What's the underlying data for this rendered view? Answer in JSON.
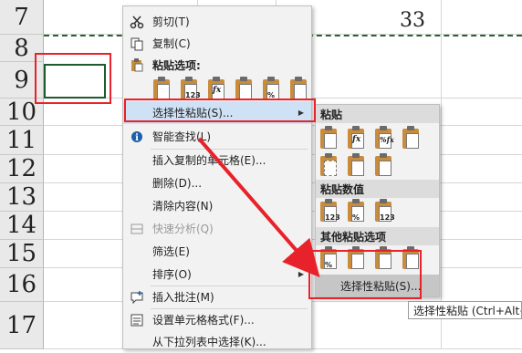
{
  "sheet": {
    "row_numbers": [
      "7",
      "8",
      "9",
      "10",
      "11",
      "12",
      "13",
      "14",
      "15",
      "16",
      "17"
    ],
    "cell_value": "33"
  },
  "context_menu": {
    "items": [
      {
        "label": "剪切(T)",
        "icon": "scissors-icon"
      },
      {
        "label": "复制(C)",
        "icon": "copy-icon"
      },
      {
        "label": "粘贴选项:",
        "icon": "paste-icon",
        "section": true
      },
      {
        "label": "选择性粘贴(S)...",
        "submenu": true
      },
      {
        "label": "智能查找(L)",
        "icon": "smart-lookup-icon"
      },
      {
        "label": "插入复制的单元格(E)..."
      },
      {
        "label": "删除(D)..."
      },
      {
        "label": "清除内容(N)"
      },
      {
        "label": "快速分析(Q)",
        "icon": "quick-analysis-icon",
        "disabled": true
      },
      {
        "label": "筛选(E)",
        "submenu": true
      },
      {
        "label": "排序(O)",
        "submenu": true
      },
      {
        "label": "插入批注(M)",
        "icon": "comment-icon"
      },
      {
        "label": "设置单元格格式(F)...",
        "icon": "format-cells-icon"
      },
      {
        "label": "从下拉列表中选择(K)..."
      }
    ],
    "paste_option_tags": [
      "",
      "123",
      "fx",
      "",
      "%",
      ""
    ]
  },
  "submenu": {
    "section_paste": "粘贴",
    "section_values": "粘贴数值",
    "section_other": "其他粘贴选项",
    "paste_tags": [
      "",
      "fx",
      "%fx",
      "",
      "",
      "",
      ""
    ],
    "value_tags": [
      "123",
      "%",
      "123"
    ],
    "other_tags": [
      "%",
      "",
      "",
      ""
    ],
    "footer_label": "选择性粘贴(S)..."
  },
  "tooltip": "选择性粘贴 (Ctrl+Alt+V)",
  "colors": {
    "annotation_red": "#e8222a",
    "highlight": "#cfe1f5",
    "menu_bg": "#f2f2f2"
  }
}
